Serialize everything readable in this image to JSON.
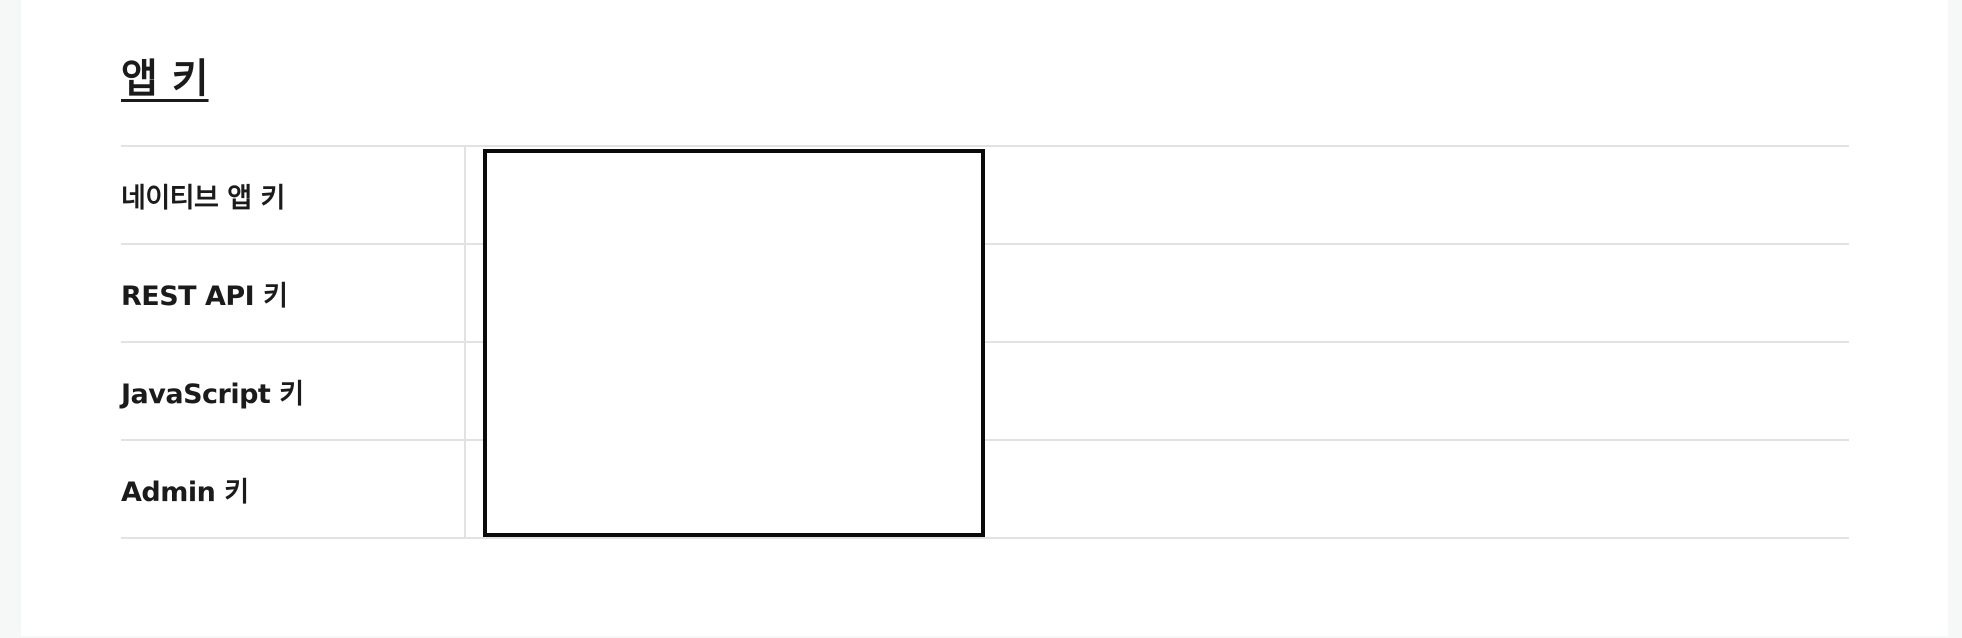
{
  "section": {
    "title": "앱 키"
  },
  "keys": [
    {
      "label": "네이티브 앱 키"
    },
    {
      "label": "REST API 키"
    },
    {
      "label": "JavaScript 키"
    },
    {
      "label": "Admin 키"
    }
  ]
}
